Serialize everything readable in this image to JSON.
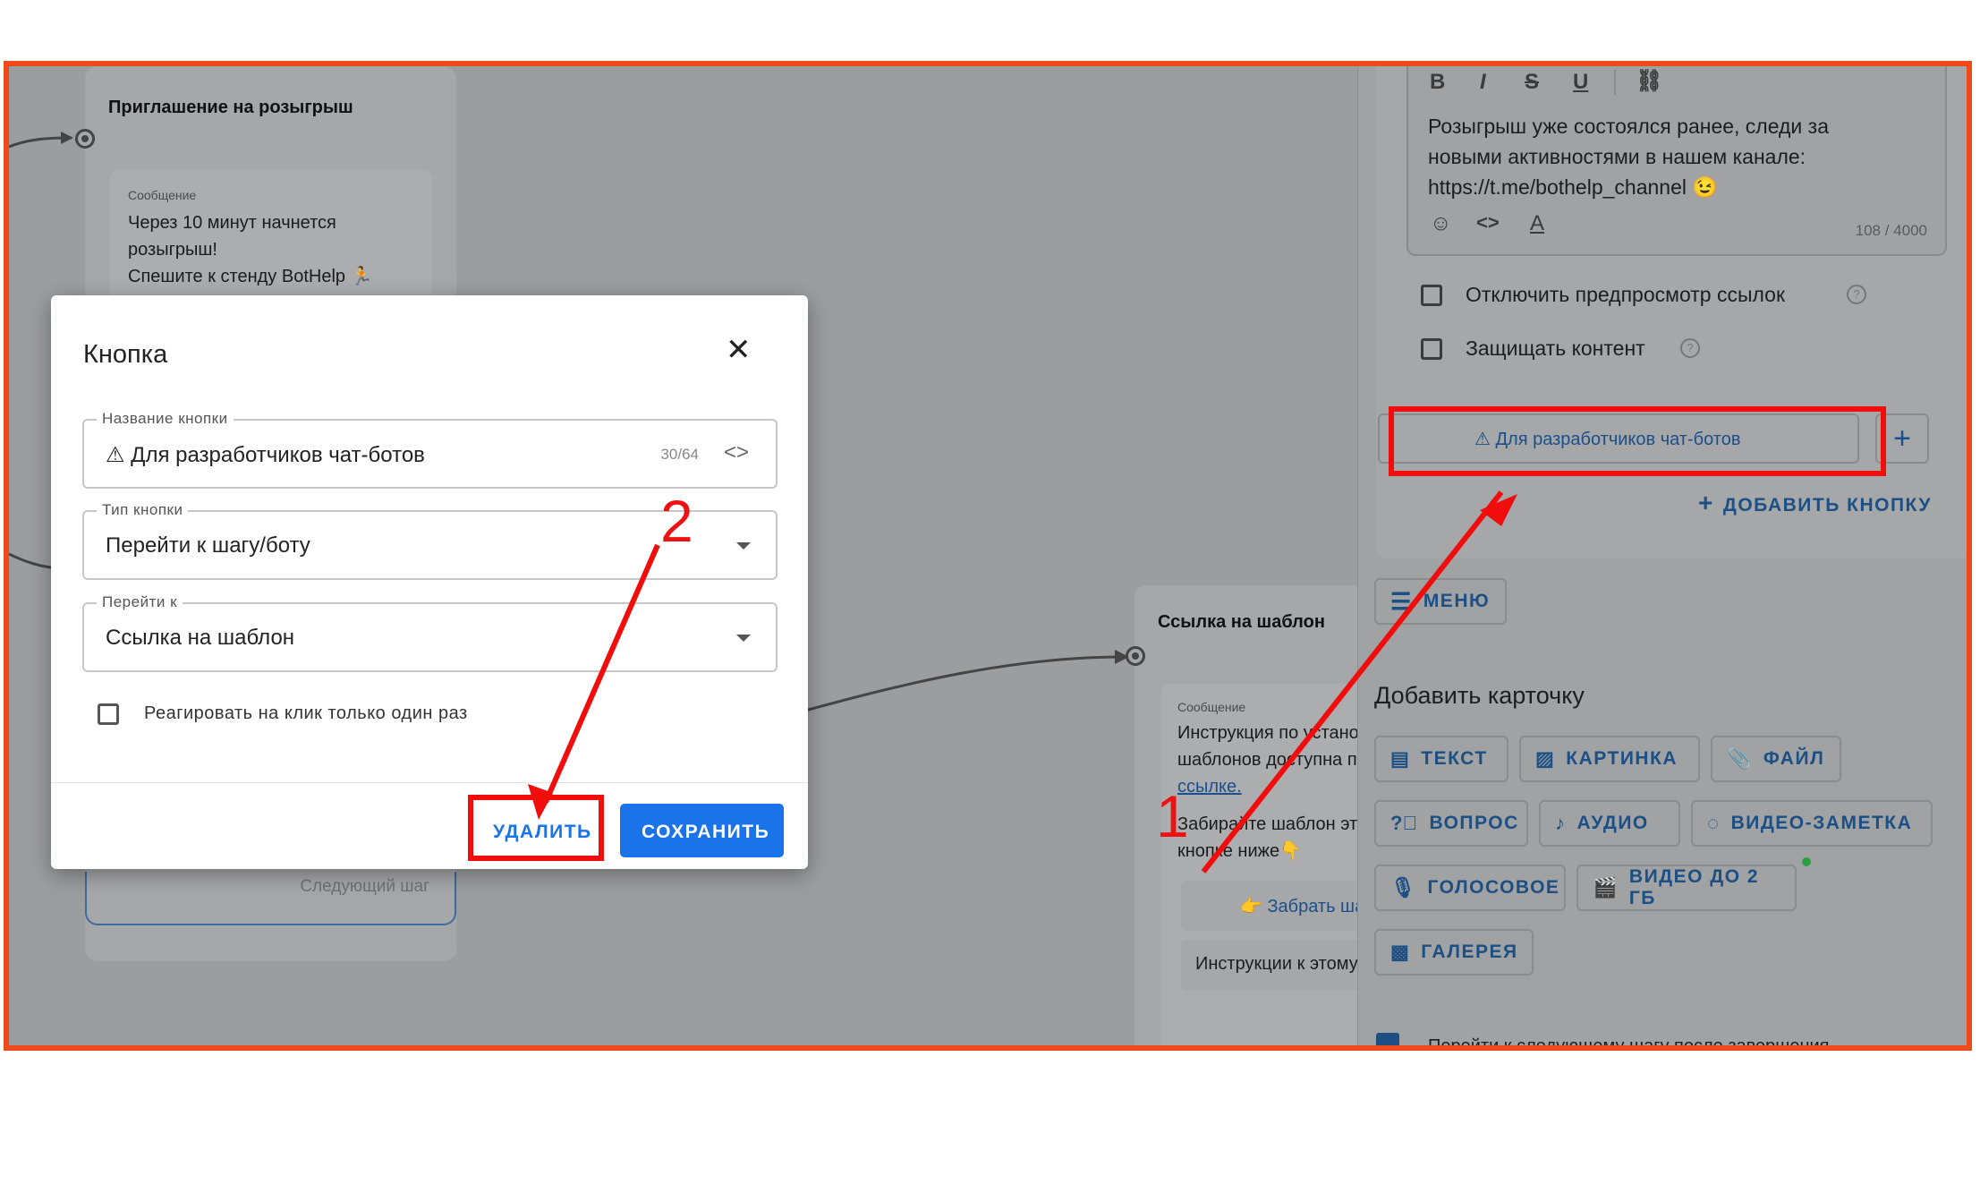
{
  "canvas": {
    "node1": {
      "title": "Приглашение на розыгрыш",
      "card_label": "Сообщение",
      "text_lines": [
        "Через 10 минут начнется",
        "розыгрыш!",
        "Спешите к стенду BotHelp 🏃"
      ],
      "next_step": "Следующий шаг"
    },
    "node2": {
      "title": "Ссылка на шаблон",
      "card_label": "Сообщение",
      "text_lines": [
        "Инструкция по устано",
        "шаблонов доступна п"
      ],
      "link": "ссылке.",
      "text2_lines": [
        "Забирайте шаблон эт",
        "кнопке ниже👇"
      ],
      "button1": "👉 Забрать ша",
      "button2": "Инструкции к этому"
    }
  },
  "right_panel": {
    "message_text": [
      "Розыгрыш уже состоялся ранее, следи за",
      "новыми активностями в нашем канале:",
      "https://t.me/bothelp_channel 😉"
    ],
    "char_count": "108 / 4000",
    "disable_preview_label": "Отключить предпросмотр ссылок",
    "protect_content_label": "Защищать контент",
    "button_chip_label": "⚠ Для разработчиков чат-ботов",
    "add_button_label": "ДОБАВИТЬ КНОПКУ",
    "menu_label": "МЕНЮ",
    "add_card_title": "Добавить карточку",
    "cards": {
      "text": "ТЕКСТ",
      "image": "КАРТИНКА",
      "file": "ФАЙЛ",
      "question": "ВОПРОС",
      "audio": "АУДИО",
      "video_note": "ВИДЕО-ЗАМЕТКА",
      "voice": "ГОЛОСОВОЕ",
      "video": "ВИДЕО ДО 2 ГБ",
      "gallery": "ГАЛЕРЕЯ"
    },
    "next_step_checkbox": "Перейти к следующему шагу после завершения"
  },
  "dialog": {
    "title": "Кнопка",
    "name_field": {
      "label": "Название кнопки",
      "value": "⚠ Для разработчиков чат-ботов",
      "counter": "30/64"
    },
    "type_field": {
      "label": "Тип кнопки",
      "value": "Перейти к шагу/боту"
    },
    "goto_field": {
      "label": "Перейти к",
      "value": "Ссылка на шаблон"
    },
    "once_checkbox": "Реагировать на клик только один раз",
    "delete_button": "УДАЛИТЬ",
    "save_button": "СОХРАНИТЬ"
  },
  "annotations": {
    "one": "1",
    "two": "2"
  },
  "colors": {
    "accent": "#1a73e8",
    "annotation": "#f20d0d",
    "frame": "#ee4a1c"
  }
}
